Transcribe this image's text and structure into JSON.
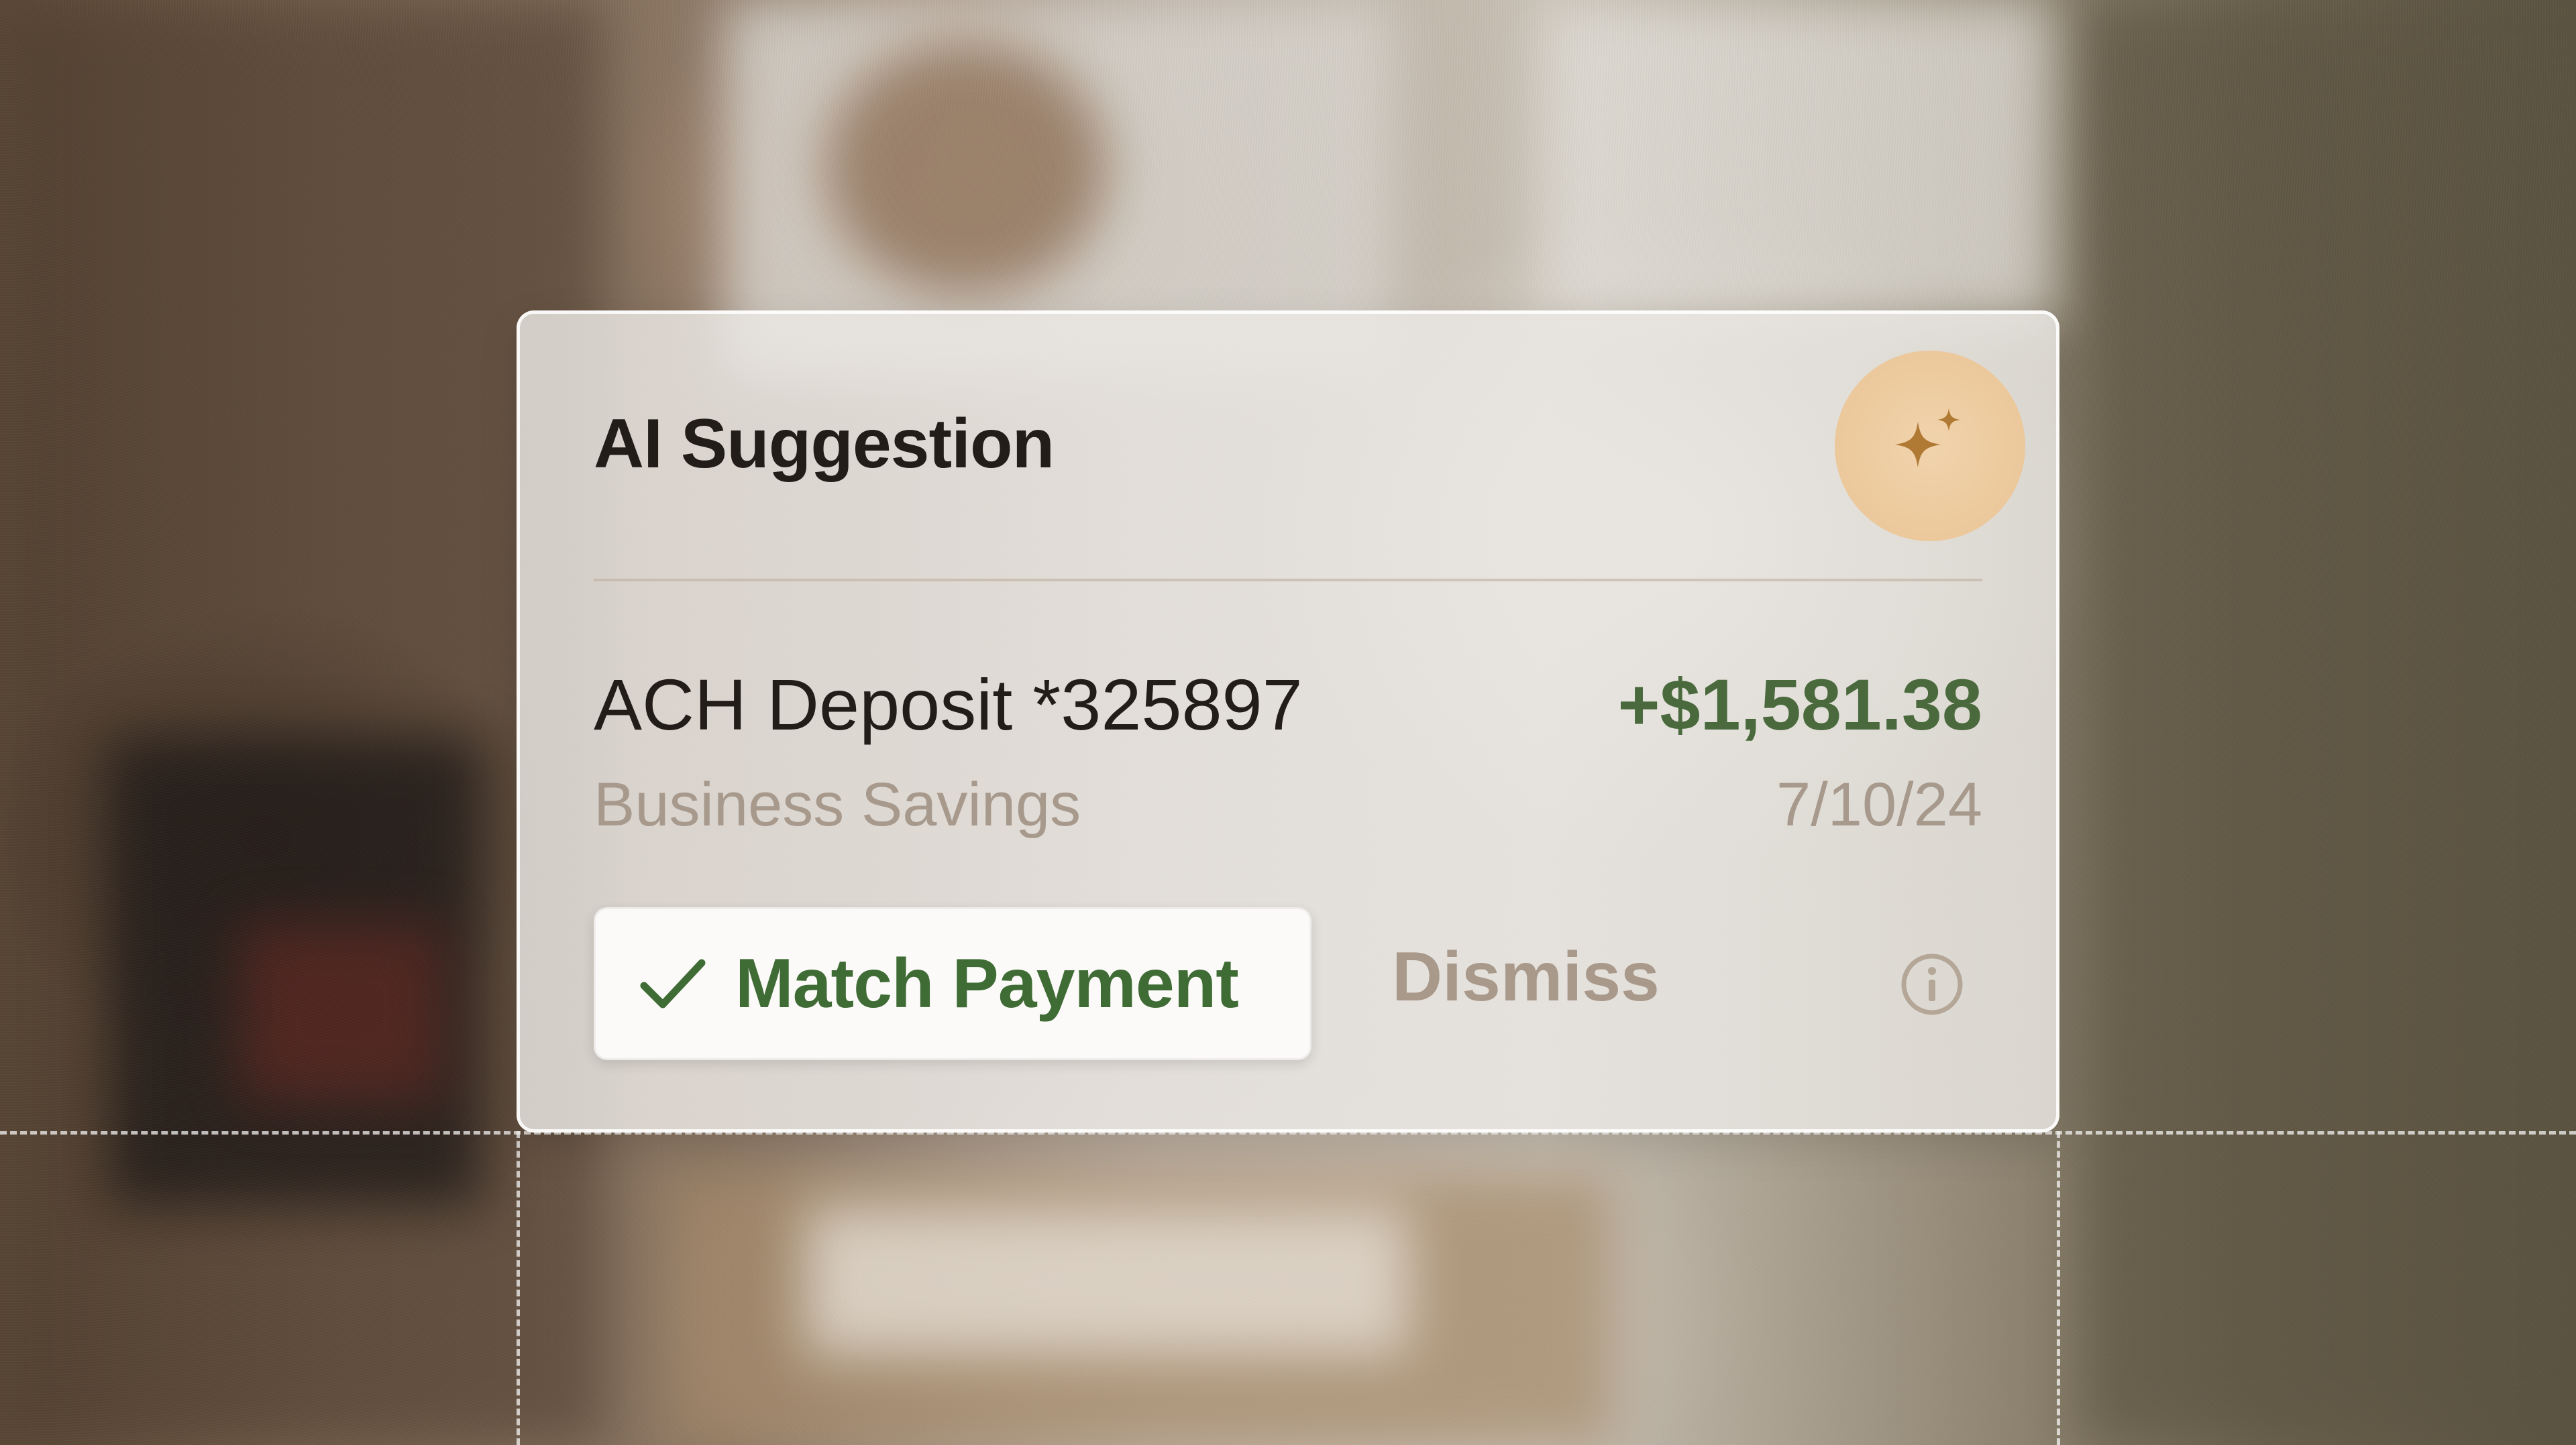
{
  "card": {
    "title": "AI Suggestion",
    "ai_badge_icon": "sparkle-icon",
    "transaction": {
      "name": "ACH Deposit *325897",
      "amount": "+$1,581.38",
      "account": "Business Savings",
      "date": "7/10/24"
    },
    "actions": {
      "match_label": "Match Payment",
      "match_icon": "checkmark-icon",
      "dismiss_label": "Dismiss",
      "info_icon": "info-icon"
    }
  },
  "colors": {
    "amount": "#4a6a3e",
    "match_label": "#3f6b35",
    "muted_text": "#a7998c",
    "badge": "#eccb9f",
    "sparkle": "#b07a35"
  }
}
